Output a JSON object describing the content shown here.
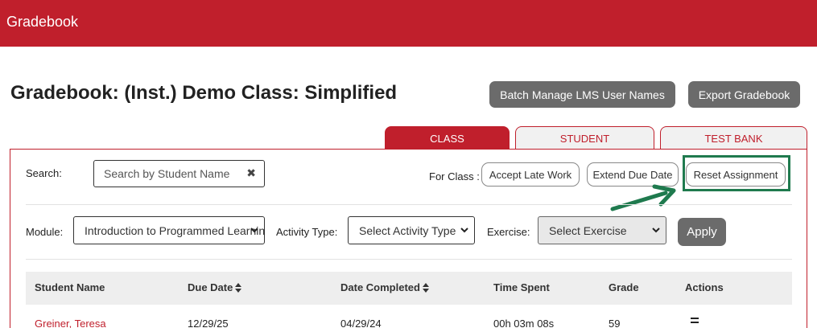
{
  "topbar": {
    "title": "Gradebook"
  },
  "page": {
    "title": "Gradebook: (Inst.) Demo Class: Simplified"
  },
  "buttons": {
    "batch": "Batch Manage LMS User Names",
    "export": "Export Gradebook",
    "apply": "Apply"
  },
  "tabs": [
    {
      "label": "CLASS",
      "active": true
    },
    {
      "label": "STUDENT"
    },
    {
      "label": "TEST BANK"
    }
  ],
  "search": {
    "label": "Search:",
    "placeholder": "Search by Student Name",
    "value": ""
  },
  "for_class": {
    "label": "For Class :",
    "actions": {
      "late": "Accept Late Work",
      "extend": "Extend Due Date",
      "reset": "Reset Assignment"
    }
  },
  "filters": {
    "module": {
      "label": "Module:",
      "value": "Introduction to Programmed Learning"
    },
    "activity": {
      "label": "Activity Type:",
      "value": "Select Activity Type"
    },
    "exercise": {
      "label": "Exercise:",
      "value": "Select Exercise"
    }
  },
  "table": {
    "headers": {
      "name": "Student Name",
      "due": "Due Date",
      "completed": "Date Completed",
      "time": "Time Spent",
      "grade": "Grade",
      "actions": "Actions"
    },
    "rows": [
      {
        "name": "Greiner, Teresa",
        "due": "12/29/25",
        "completed": "04/29/24",
        "time": "00h 03m 08s",
        "grade": "59"
      }
    ]
  },
  "colors": {
    "brand": "#c01f2c",
    "highlight": "#1f7a4e",
    "button": "#6b6b6b"
  },
  "icons": {
    "clear": "close-x-icon",
    "sort": "sort-icon",
    "row_menu": "hamburger-menu-icon",
    "callout": "arrow-icon"
  }
}
